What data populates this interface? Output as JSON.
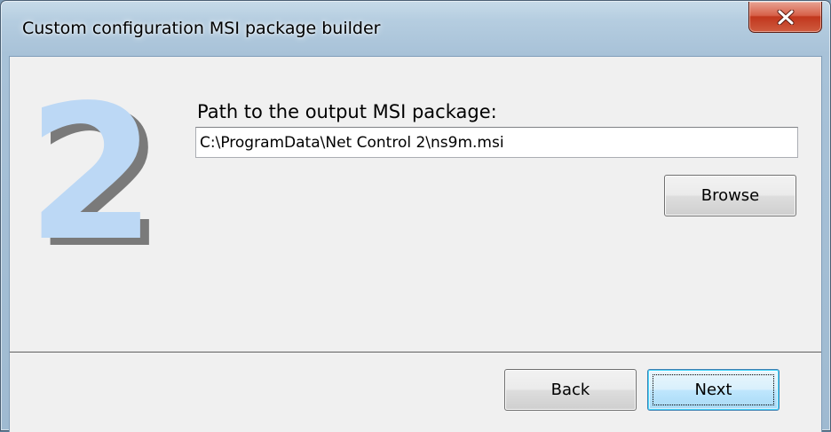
{
  "window": {
    "title": "Custom configuration MSI package builder"
  },
  "icons": {
    "close": "close-icon"
  },
  "step": {
    "number": "2",
    "color_front": "#bcd8f5",
    "color_shadow": "#7a7a7a"
  },
  "output": {
    "label": "Path to the output MSI package:",
    "value": "C:\\ProgramData\\Net Control 2\\ns9m.msi"
  },
  "buttons": {
    "browse": "Browse",
    "back": "Back",
    "next": "Next"
  }
}
